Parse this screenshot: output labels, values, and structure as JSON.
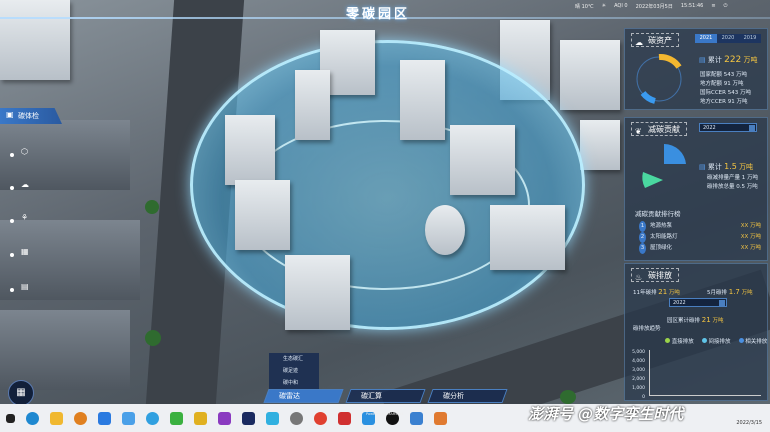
{
  "header": {
    "title": "零碳园区",
    "weather": "晴 10℃",
    "aqi": "AQI 0",
    "date": "2022年03月5日",
    "time": "15:51:46"
  },
  "carbon_assets": {
    "title": "碳资产",
    "tabs": [
      "2021",
      "2020",
      "2019"
    ],
    "active_tab": "2021",
    "total_label": "累计",
    "total_value": "222",
    "total_unit": "万吨",
    "items": [
      {
        "label": "国家配额",
        "value": "543",
        "unit": "万吨"
      },
      {
        "label": "地方配额",
        "value": "91",
        "unit": "万吨"
      },
      {
        "label": "国际CCER",
        "value": "543",
        "unit": "万吨"
      },
      {
        "label": "地方CCER",
        "value": "91",
        "unit": "万吨"
      }
    ]
  },
  "reduction": {
    "title": "减碳贡献",
    "year": "2022",
    "total_label": "累计",
    "total_value": "1.5",
    "total_unit": "万吨",
    "lines": [
      {
        "label": "碳减排量产量",
        "value": "1",
        "unit": "万吨"
      },
      {
        "label": "碳排放总量",
        "value": "0.5",
        "unit": "万吨"
      }
    ],
    "rank_title": "减碳贡献排行榜",
    "rank": [
      {
        "no": "1",
        "name": "地源热泵",
        "value": "XX",
        "unit": "万吨"
      },
      {
        "no": "2",
        "name": "太阳能路灯",
        "value": "XX",
        "unit": "万吨"
      },
      {
        "no": "3",
        "name": "屋顶绿化",
        "value": "XX",
        "unit": "万吨"
      }
    ]
  },
  "emission": {
    "title": "碳排放",
    "year_label": "11年碳排",
    "year_value": "21",
    "year_unit": "万吨",
    "month_label": "5月碳排",
    "month_value": "1.7",
    "month_unit": "万吨",
    "select": "2022",
    "park_label": "园区累计碳排",
    "park_value": "21",
    "park_unit": "万吨",
    "trend_title": "碳排放趋势",
    "legend": [
      "直接排放",
      "间接排放",
      "相关排放"
    ],
    "legend_colors": [
      "#9bd34a",
      "#5fc4e8",
      "#4a8fe0"
    ],
    "yticks": [
      "5,000",
      "4,000",
      "3,000",
      "2,000",
      "1,000",
      "0"
    ]
  },
  "nav": {
    "active": "碳体检"
  },
  "bottom": {
    "menu": [
      "生态碳汇",
      "碳足迹",
      "碳中和"
    ],
    "buttons": [
      "碳雷达",
      "碳汇算",
      "碳分析"
    ],
    "powered": "Powered by MARSGIS",
    "command": "Command"
  },
  "taskbar": {
    "date": "2022/3/15"
  },
  "watermark": "澎湃号 @数字孪生时代"
}
